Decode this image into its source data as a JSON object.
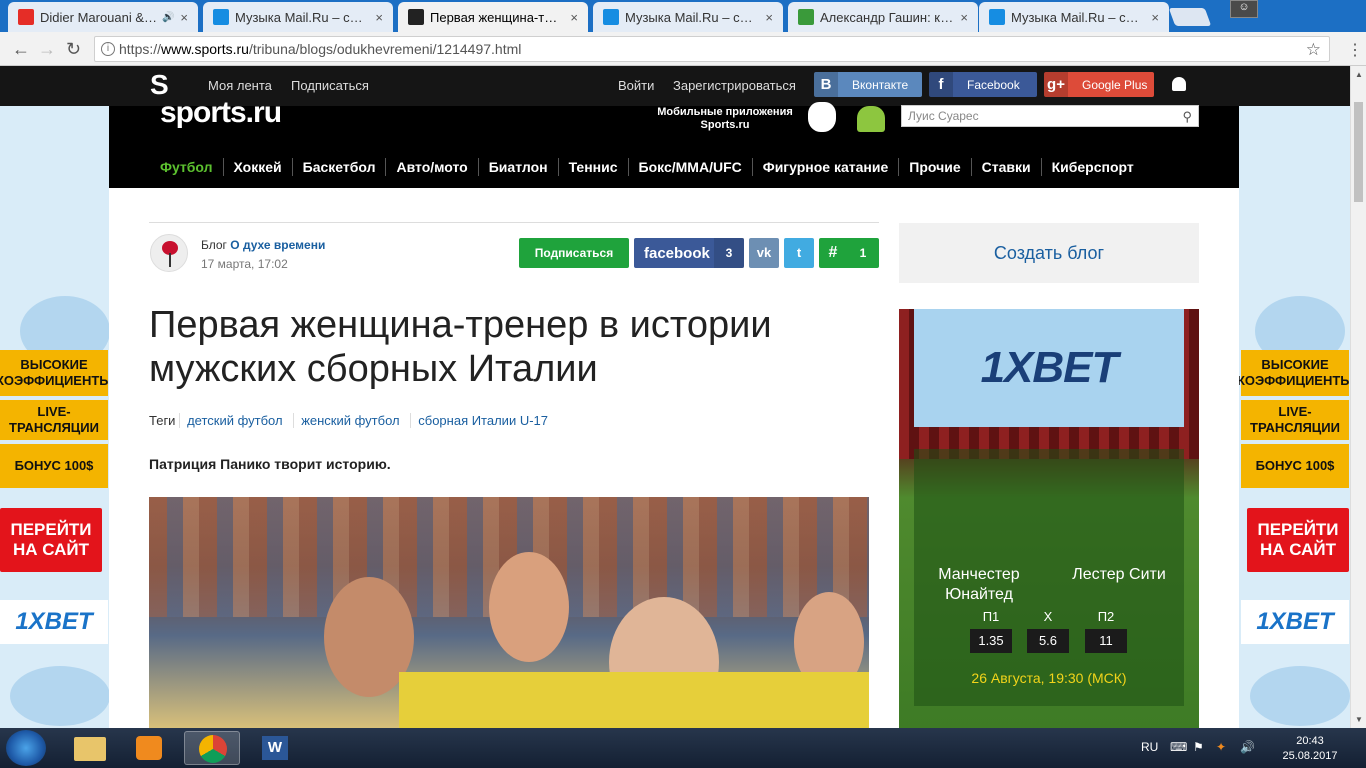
{
  "browser": {
    "tabs": [
      {
        "title": "Didier Marouani & Sp",
        "favicon_color": "#e52d27",
        "favicon_icon": "youtube-icon",
        "extra": "🔊"
      },
      {
        "title": "Музыка Mail.Ru – слуша",
        "favicon_color": "#168de2",
        "favicon_icon": "mail-music-icon"
      },
      {
        "title": "Первая женщина-трене",
        "favicon_color": "#222222",
        "favicon_icon": "sports-s-icon",
        "active": true
      },
      {
        "title": "Музыка Mail.Ru – слуша",
        "favicon_color": "#168de2",
        "favicon_icon": "mail-music-icon"
      },
      {
        "title": "Александр Гашин: кабі",
        "favicon_color": "#3a9a3a",
        "favicon_icon": "green-square-icon"
      },
      {
        "title": "Музыка Mail.Ru – слуша",
        "favicon_color": "#168de2",
        "favicon_icon": "mail-music-icon"
      }
    ],
    "close_glyph": "×",
    "url_scheme": "https://",
    "url_domain": "www.sports.ru",
    "url_path": "/tribuna/blogs/odukhevremeni/1214497.html"
  },
  "header": {
    "logo_letter": "S",
    "logo_text": "sports.ru",
    "nav": [
      "Моя лента",
      "Подписаться"
    ],
    "login": "Войти",
    "register": "Зарегистрироваться",
    "social": [
      {
        "label": "Вконтакте",
        "icon": "В",
        "color": "#5b88bd"
      },
      {
        "label": "Facebook",
        "icon": "f",
        "color": "#3b5998"
      },
      {
        "label": "Google Plus",
        "icon": "g+",
        "color": "#dd4b39"
      }
    ],
    "mobile_apps_line1": "Мобильные приложения",
    "mobile_apps_line2": "Sports.ru",
    "search_placeholder": "Луис Суарес",
    "sports_nav": [
      "Футбол",
      "Хоккей",
      "Баскетбол",
      "Авто/мото",
      "Биатлон",
      "Теннис",
      "Бокс/MMA/UFC",
      "Фигурное катание",
      "Прочие",
      "Ставки",
      "Киберспорт"
    ]
  },
  "article": {
    "blog_prefix": "Блог",
    "blog_name": "О духе времени",
    "date": "17 марта, 17:02",
    "subscribe": "Подписаться",
    "facebook_label": "facebook",
    "facebook_count": "3",
    "hash_count": "1",
    "hash_glyph": "#",
    "vk_glyph": "vk",
    "twitter_glyph": "t",
    "title_line1": "Первая женщина-тренер в истории",
    "title_line2": "мужских сборных Италии",
    "tags_label": "Теги",
    "tags": [
      "детский футбол",
      "женский футбол",
      "сборная Италии U-17"
    ],
    "lead": "Патриция Панико творит историю."
  },
  "sidebar": {
    "create_blog": "Создать блог",
    "ad": {
      "logo": "1XBET",
      "team1": "Манчестер Юнайтед",
      "team2": "Лестер Сити",
      "odds_headers": [
        "П1",
        "Х",
        "П2"
      ],
      "odds": [
        "1.35",
        "5.6",
        "11"
      ],
      "date": "26 Августа, 19:30 (МСК)"
    }
  },
  "side_promos": {
    "odds": "ВЫСОКИЕ КОЭФФИЦИЕНТЫ",
    "live": "LIVE-ТРАНСЛЯЦИИ",
    "bonus": "БОНУС 100$",
    "go": "ПЕРЕЙТИ НА САЙТ",
    "logo": "1XBET"
  },
  "taskbar": {
    "lang": "RU",
    "time": "20:43",
    "date": "25.08.2017"
  }
}
